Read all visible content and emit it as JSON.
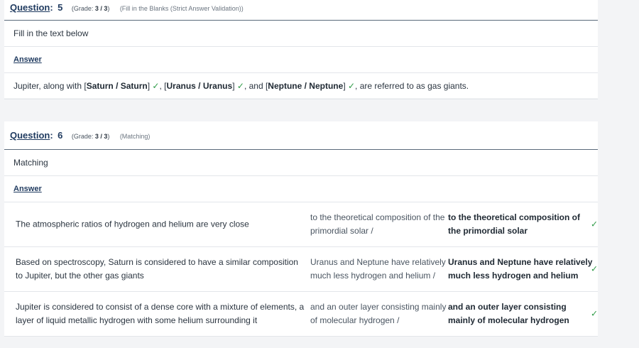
{
  "q5": {
    "label": "Question",
    "number": "5",
    "grade_prefix": "(Grade: ",
    "grade_value": "3 / 3",
    "grade_suffix": ")",
    "type": "(Fill in the Blanks (Strict Answer Validation))",
    "prompt": "Fill in the text below",
    "answer_label": "Answer",
    "sentence": {
      "t0": "Jupiter, along with [",
      "a1": "Saturn / Saturn",
      "t1": "] ",
      "t2": ", [",
      "a2": "Uranus / Uranus",
      "t3": "] ",
      "t4": ", and [",
      "a3": "Neptune / Neptune",
      "t5": "] ",
      "t6": ", are referred to as gas giants."
    },
    "check": "✓"
  },
  "q6": {
    "label": "Question",
    "number": "6",
    "grade_prefix": "(Grade: ",
    "grade_value": "3 / 3",
    "grade_suffix": ")",
    "type": "(Matching)",
    "prompt": "Matching",
    "answer_label": "Answer",
    "rows": [
      {
        "statement": "The atmospheric ratios of hydrogen and helium are very close",
        "response": "to the theoretical composition of the primordial solar /",
        "correct": "to the theoretical composition of the primordial solar",
        "check": "✓"
      },
      {
        "statement": "Based on spectroscopy, Saturn is considered to have a similar composition to Jupiter, but the other gas giants",
        "response": "Uranus and Neptune have relatively much less hydrogen and helium /",
        "correct": "Uranus and Neptune have relatively much less hydrogen and helium",
        "check": "✓"
      },
      {
        "statement": "Jupiter is considered to consist of a dense core with a mixture of elements, a layer of liquid metallic hydrogen with some helium surrounding it",
        "response": "and an outer layer consisting mainly of molecular hydrogen /",
        "correct": "and an outer layer consisting mainly of molecular hydrogen",
        "check": "✓"
      }
    ]
  },
  "colors": {
    "accent": "#1f3a5f",
    "success": "#2e9b47",
    "text": "#2b3540"
  }
}
